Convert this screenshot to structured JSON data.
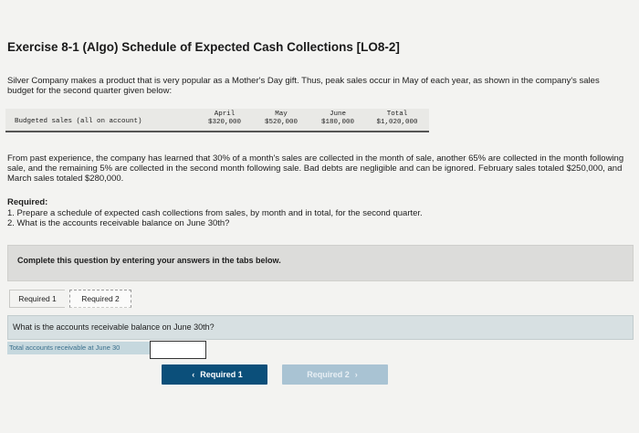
{
  "title": "Exercise 8-1 (Algo) Schedule of Expected Cash Collections [LO8-2]",
  "intro": "Silver Company makes a product that is very popular as a Mother's Day gift. Thus, peak sales occur in May of each year, as shown in the company's sales budget for the second quarter given below:",
  "budget": {
    "label": "Budgeted sales (all on account)",
    "columns": [
      {
        "month": "April",
        "value": "$320,000"
      },
      {
        "month": "May",
        "value": "$520,000"
      },
      {
        "month": "June",
        "value": "$180,000"
      },
      {
        "month": "Total",
        "value": "$1,020,000"
      }
    ]
  },
  "paragraph": "From past experience, the company has learned that 30% of a month's sales are collected in the month of sale, another 65% are collected in the month following sale, and the remaining 5% are collected in the second month following sale. Bad debts are negligible and can be ignored. February sales totaled $250,000, and March sales totaled $280,000.",
  "required": {
    "heading": "Required:",
    "items": [
      "1. Prepare a schedule of expected cash collections from sales, by month and in total, for the second quarter.",
      "2. What is the accounts receivable balance on June 30th?"
    ]
  },
  "instruction": "Complete this question by entering your answers in the tabs below.",
  "tabs": [
    {
      "label": "Required 1"
    },
    {
      "label": "Required 2"
    }
  ],
  "question": "What is the accounts receivable balance on June 30th?",
  "answer": {
    "label": "Total accounts receivable at June 30",
    "value": ""
  },
  "nav": {
    "prev_label": "Required 1",
    "prev_icon": "‹",
    "next_label": "Required 2",
    "next_icon": "›"
  },
  "colors": {
    "primary_button": "#0b4f7a",
    "disabled_button": "#a9c3d3",
    "question_bar": "#d7e0e2"
  }
}
